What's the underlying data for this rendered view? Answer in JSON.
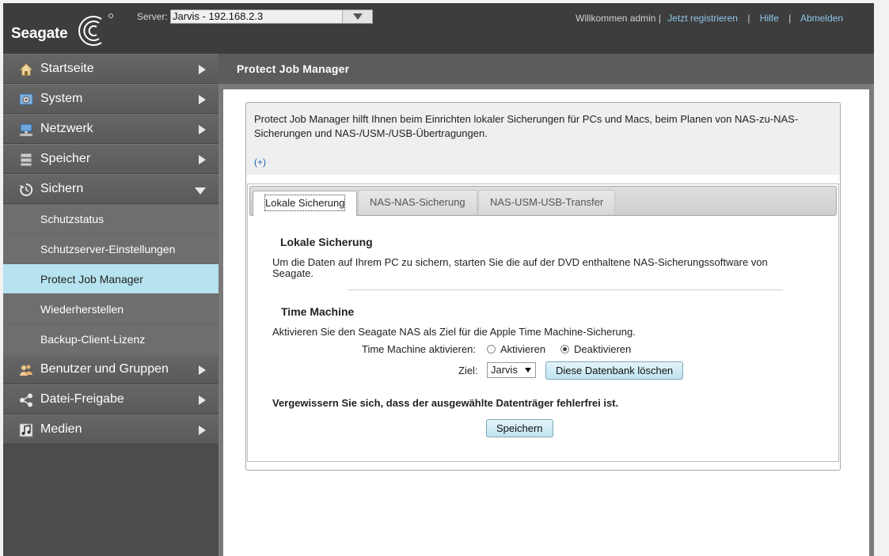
{
  "brand": {
    "name": "Seagate"
  },
  "header": {
    "server_label": "Server:",
    "server_value": "Jarvis - 192.168.2.3",
    "welcome": "Willkommen admin |",
    "register": "Jetzt registrieren",
    "help": "Hilfe",
    "logout": "Abmelden",
    "separator": "|"
  },
  "sidebar": {
    "items": [
      {
        "label": "Startseite",
        "icon": "home-icon"
      },
      {
        "label": "System",
        "icon": "gear-icon"
      },
      {
        "label": "Netzwerk",
        "icon": "network-icon"
      },
      {
        "label": "Speicher",
        "icon": "storage-icon"
      },
      {
        "label": "Sichern",
        "icon": "backup-icon"
      },
      {
        "label": "Benutzer und Gruppen",
        "icon": "users-icon"
      },
      {
        "label": "Datei-Freigabe",
        "icon": "share-icon"
      },
      {
        "label": "Medien",
        "icon": "media-icon"
      }
    ],
    "sub_items": [
      "Schutzstatus",
      "Schutzserver-Einstellungen",
      "Protect Job Manager",
      "Wiederherstellen",
      "Backup-Client-Lizenz"
    ],
    "active_sub": "Protect Job Manager"
  },
  "main": {
    "title": "Protect Job Manager",
    "intro_line1": "Protect Job Manager hilft Ihnen beim Einrichten lokaler Sicherungen für PCs und Macs, beim Planen von NAS-zu-NAS-",
    "intro_line2": "Sicherungen und NAS-/USM-/USB-Übertragungen.",
    "more_link": "(+)",
    "tabs": [
      "Lokale Sicherung",
      "NAS-NAS-Sicherung",
      "NAS-USM-USB-Transfer"
    ],
    "active_tab": "Lokale Sicherung",
    "local": {
      "title": "Lokale Sicherung",
      "text_line1": "Um die Daten auf Ihrem PC zu sichern, starten Sie die auf der DVD enthaltene NAS-Sicherungssoftware von",
      "text_line2": "Seagate."
    },
    "time_machine": {
      "title": "Time Machine",
      "description": "Aktivieren Sie den Seagate NAS als Ziel für die Apple Time Machine-Sicherung.",
      "enable_label": "Time Machine aktivieren:",
      "option_on": "Aktivieren",
      "option_off": "Deaktivieren",
      "selected": "Deaktivieren",
      "target_label": "Ziel:",
      "target_value": "Jarvis",
      "delete_button": "Diese Datenbank löschen"
    },
    "warning": "Vergewissern Sie sich, dass der ausgewählte Datenträger fehlerfrei ist.",
    "save_button": "Speichern"
  },
  "colors": {
    "header_bg": "#3d3d3d",
    "active_sub_bg": "#b6e3ef",
    "link": "#8ec8e8"
  }
}
